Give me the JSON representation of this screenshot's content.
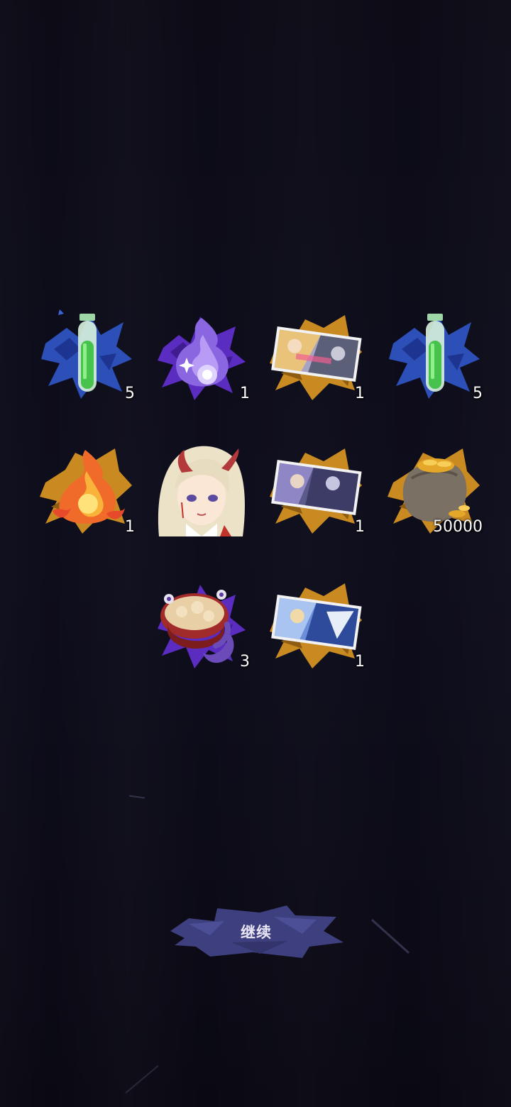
{
  "rewards": [
    {
      "icon": "green-potion-icon",
      "count": "5",
      "rarity": "blue"
    },
    {
      "icon": "purple-spirit-flame-icon",
      "count": "1",
      "rarity": "purple"
    },
    {
      "icon": "character-card-icon",
      "count": "1",
      "rarity": "gold"
    },
    {
      "icon": "green-potion-icon",
      "count": "5",
      "rarity": "blue"
    },
    {
      "icon": "fire-essence-icon",
      "count": "1",
      "rarity": "gold"
    },
    {
      "icon": "oni-girl-portrait",
      "count": "",
      "rarity": "none"
    },
    {
      "icon": "character-card-icon",
      "count": "1",
      "rarity": "gold"
    },
    {
      "icon": "gold-coin-sack-icon",
      "count": "50000",
      "rarity": "gold"
    },
    {
      "icon": "tentacle-noodle-bowl-icon",
      "count": "3",
      "rarity": "purple"
    },
    {
      "icon": "character-card-icon",
      "count": "1",
      "rarity": "gold"
    }
  ],
  "continue_button": {
    "label": "继续"
  },
  "colors": {
    "blue": "#2c4fb8",
    "purple": "#5a2cc0",
    "gold": "#c98a22",
    "button": "#4a4a8a"
  }
}
